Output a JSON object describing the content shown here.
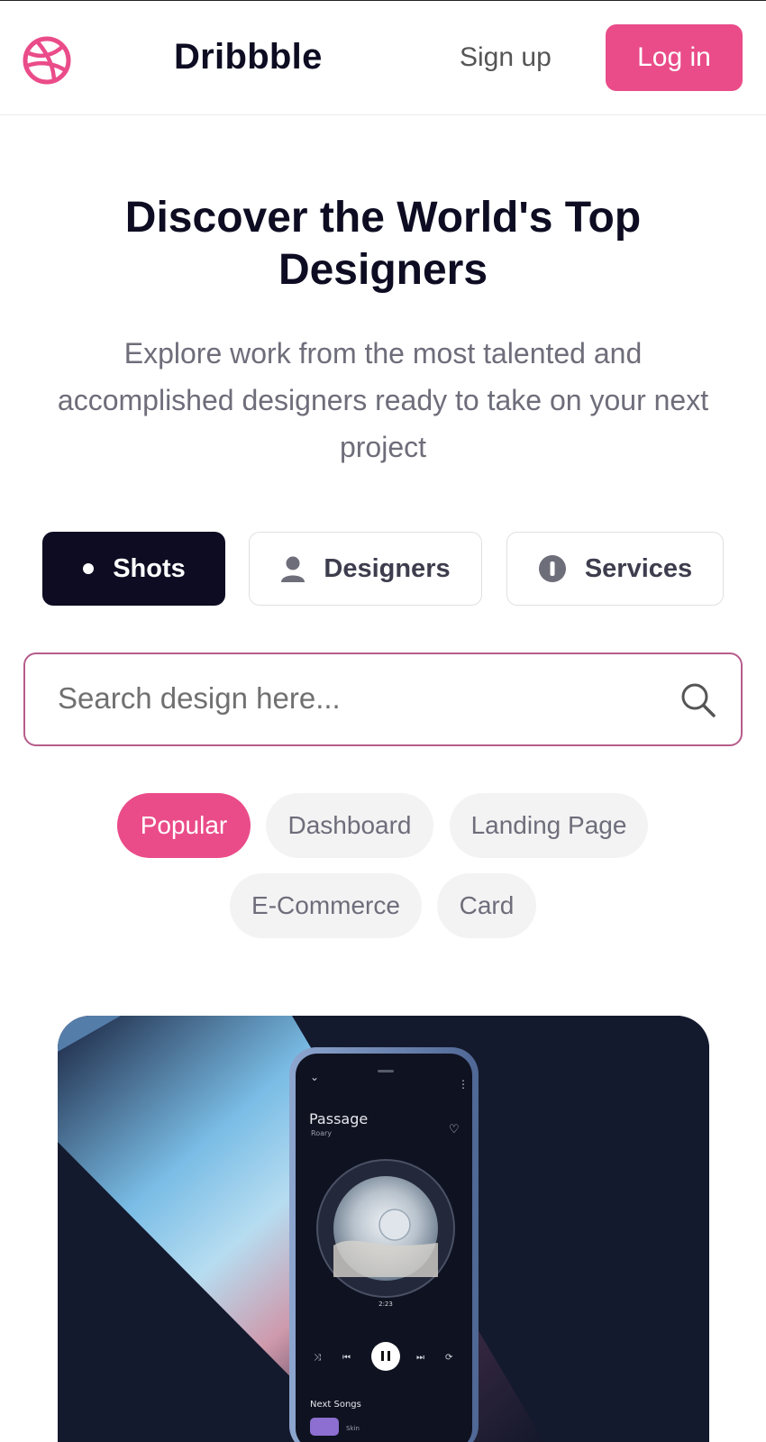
{
  "header": {
    "brand": "Dribbble",
    "signup_label": "Sign up",
    "login_label": "Log in",
    "accent": "#ea4c89"
  },
  "hero": {
    "title_line1": "Discover the World's Top",
    "title_line2": "Designers",
    "subtitle_line1": "Explore work from the most talented and",
    "subtitle_line2": "accomplished designers ready to take on your next",
    "subtitle_line3": "project"
  },
  "segments": [
    {
      "label": "Shots",
      "icon": "dot-icon",
      "active": true
    },
    {
      "label": "Designers",
      "icon": "person-icon",
      "active": false
    },
    {
      "label": "Services",
      "icon": "info-icon",
      "active": false
    }
  ],
  "search": {
    "placeholder": "Search design here..."
  },
  "filters": [
    {
      "label": "Popular",
      "active": true
    },
    {
      "label": "Dashboard",
      "active": false
    },
    {
      "label": "Landing Page",
      "active": false
    },
    {
      "label": "E-Commerce",
      "active": false
    },
    {
      "label": "Card",
      "active": false
    }
  ],
  "shot": {
    "song_title": "Passage",
    "artist": "Roary",
    "time": "2:23",
    "next_songs_label": "Next Songs",
    "next_item": "Skin"
  }
}
